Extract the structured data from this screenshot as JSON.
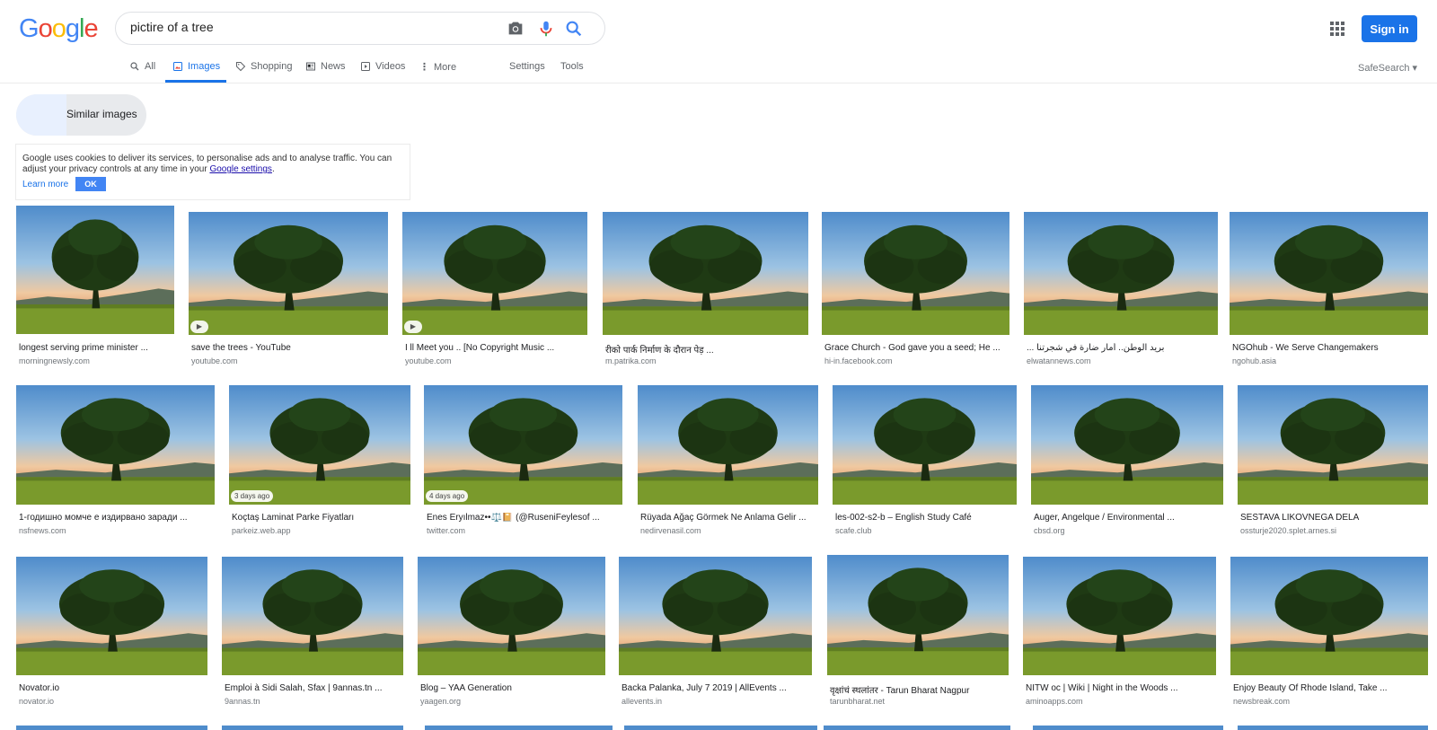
{
  "search": {
    "query": "pictire of a tree"
  },
  "header": {
    "signin_label": "Sign in",
    "safesearch": "SafeSearch ▾"
  },
  "tabs": [
    {
      "label": "All"
    },
    {
      "label": "Images"
    },
    {
      "label": "Shopping"
    },
    {
      "label": "News"
    },
    {
      "label": "Videos"
    },
    {
      "label": "More"
    },
    {
      "label": "Settings"
    },
    {
      "label": "Tools"
    }
  ],
  "similar": {
    "label": "Similar images"
  },
  "cookie": {
    "text": "Google uses cookies to deliver its services, to personalise ads and to analyse traffic. You can adjust your privacy controls at any time in your",
    "link": "Google settings",
    "end": ".",
    "learn": "Learn more",
    "ok": "OK"
  },
  "results": [
    {
      "title": "longest serving prime minister ...",
      "domain": "morningnewsly.com"
    },
    {
      "title": "save the trees - YouTube",
      "domain": "youtube.com",
      "badge": "▶"
    },
    {
      "title": "I ll Meet you .. [No Copyright Music ...",
      "domain": "youtube.com",
      "badge": "▶"
    },
    {
      "title": "रीको पार्क निर्माण के दौरान पेड़ ...",
      "domain": "m.patrika.com"
    },
    {
      "title": "Grace Church - God gave you a seed; He ...",
      "domain": "hi-in.facebook.com"
    },
    {
      "title": "... بريد الوطن.. أمار ضارة في شجرتنا",
      "domain": "elwatannews.com"
    },
    {
      "title": "NGOhub - We Serve Changemakers",
      "domain": "ngohub.asia"
    },
    {
      "title": "1-годишно момче е издирвано заради ...",
      "domain": "nsfnews.com"
    },
    {
      "title": "Koçtaş Laminat Parke Fiyatları",
      "domain": "parkeiz.web.app",
      "age": "3 days ago"
    },
    {
      "title": "Enes Eryılmaz••⚖️📔 (@RuseniFeylesof ...",
      "domain": "twitter.com",
      "age": "4 days ago"
    },
    {
      "title": "Rüyada Ağaç Görmek Ne Anlama Gelir ...",
      "domain": "nedirvenasil.com"
    },
    {
      "title": "les-002-s2-b – English Study Café",
      "domain": "scafe.club"
    },
    {
      "title": "Auger, Angelque / Environmental ...",
      "domain": "cbsd.org"
    },
    {
      "title": "SESTAVA LIKOVNEGA DELA",
      "domain": "ossturje2020.splet.arnes.si"
    },
    {
      "title": "Novator.io",
      "domain": "novator.io"
    },
    {
      "title": "Emploi à Sidi Salah, Sfax | 9annas.tn ...",
      "domain": "9annas.tn"
    },
    {
      "title": "Blog – YAA Generation",
      "domain": "yaagen.org"
    },
    {
      "title": "Backa Palanka, July 7 2019 | AllEvents ...",
      "domain": "allevents.in"
    },
    {
      "title": "वृक्षांचं स्थलांतर - Tarun Bharat Nagpur",
      "domain": "tarunbharat.net"
    },
    {
      "title": "NITW oc | Wiki | Night in the Woods ...",
      "domain": "aminoapps.com"
    },
    {
      "title": "Enjoy Beauty Of Rhode Island, Take ...",
      "domain": "newsbreak.com"
    }
  ],
  "colors": {
    "accent": "#1a73e8",
    "sky": "#6aa6d8",
    "grass": "#7a9a2c",
    "tree": "#1f3a14"
  }
}
